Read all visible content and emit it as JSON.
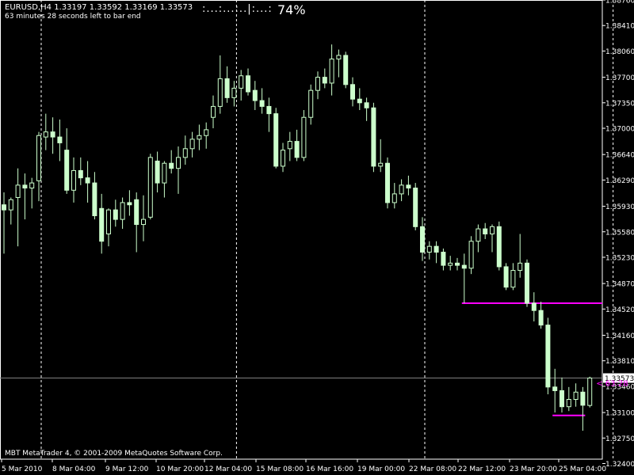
{
  "header": {
    "title": "EURUSD,H4  1.33197 1.33592 1.33169 1.33573",
    "countdown": "63 minutes 28 seconds left to bar end",
    "bar_progress_dots": ":...:...:..|:...:",
    "bar_progress_pct": "74%"
  },
  "footer": {
    "copyright": "MBT MetaTrader 4, © 2001-2009 MetaQuotes Software Corp."
  },
  "colors": {
    "background": "#000000",
    "candle": "#ccffcc",
    "axis": "#ffffff",
    "level_line": "#ff00ff",
    "price_line": "#808080"
  },
  "chart_data": {
    "type": "candlestick",
    "symbol": "EURUSD",
    "timeframe": "H4",
    "current_price": 1.33573,
    "current_price_label": "1.33573",
    "countdown_label": "< 63:28",
    "ylim": [
      1.3246,
      1.3876
    ],
    "y_ticks": [
      "1.38760",
      "1.38410",
      "1.38060",
      "1.37700",
      "1.37350",
      "1.37000",
      "1.36640",
      "1.36290",
      "1.35930",
      "1.35580",
      "1.35230",
      "1.34870",
      "1.34520",
      "1.34160",
      "1.33810",
      "1.33460",
      "1.33100",
      "1.32750",
      "1.32400"
    ],
    "x_ticks": [
      "5 Mar 2010",
      "8 Mar 04:00",
      "9 Mar 12:00",
      "10 Mar 20:00",
      "12 Mar 04:00",
      "15 Mar 08:00",
      "16 Mar 16:00",
      "19 Mar 00:00",
      "22 Mar 08:00",
      "22 Mar 12:00",
      "23 Mar 20:00",
      "25 Mar 04:00"
    ],
    "levels": [
      {
        "price": 1.346,
        "from_bar": 66
      },
      {
        "price": 1.3306,
        "from_bar": 79,
        "to_bar": 83
      }
    ],
    "candles": [
      [
        1.3595,
        1.3612,
        1.3528,
        1.3588
      ],
      [
        1.3588,
        1.3605,
        1.3568,
        1.3602
      ],
      [
        1.3605,
        1.3645,
        1.3538,
        1.3622
      ],
      [
        1.3622,
        1.3638,
        1.3575,
        1.3618
      ],
      [
        1.3618,
        1.3632,
        1.359,
        1.3625
      ],
      [
        1.3628,
        1.3695,
        1.36,
        1.369
      ],
      [
        1.3688,
        1.372,
        1.367,
        1.3695
      ],
      [
        1.3695,
        1.3715,
        1.3665,
        1.3688
      ],
      [
        1.3688,
        1.3712,
        1.3655,
        1.368
      ],
      [
        1.367,
        1.37,
        1.361,
        1.3615
      ],
      [
        1.3615,
        1.366,
        1.3598,
        1.3642
      ],
      [
        1.3642,
        1.366,
        1.3622,
        1.3632
      ],
      [
        1.3632,
        1.3655,
        1.3598,
        1.3625
      ],
      [
        1.3625,
        1.364,
        1.3575,
        1.358
      ],
      [
        1.359,
        1.361,
        1.3528,
        1.3545
      ],
      [
        1.3555,
        1.359,
        1.3538,
        1.3588
      ],
      [
        1.3588,
        1.3602,
        1.3565,
        1.3575
      ],
      [
        1.3575,
        1.3605,
        1.3562,
        1.3598
      ],
      [
        1.3598,
        1.3615,
        1.358,
        1.3595
      ],
      [
        1.3602,
        1.3612,
        1.353,
        1.3568
      ],
      [
        1.3568,
        1.3608,
        1.3545,
        1.3575
      ],
      [
        1.3578,
        1.3665,
        1.3575,
        1.366
      ],
      [
        1.3655,
        1.3668,
        1.3612,
        1.3625
      ],
      [
        1.3625,
        1.3655,
        1.3605,
        1.3652
      ],
      [
        1.3652,
        1.367,
        1.3638,
        1.3645
      ],
      [
        1.3645,
        1.3675,
        1.361,
        1.366
      ],
      [
        1.366,
        1.369,
        1.365,
        1.3672
      ],
      [
        1.3672,
        1.3695,
        1.366,
        1.3685
      ],
      [
        1.3685,
        1.3705,
        1.367,
        1.369
      ],
      [
        1.369,
        1.3708,
        1.3672,
        1.3698
      ],
      [
        1.3715,
        1.3745,
        1.37,
        1.373
      ],
      [
        1.373,
        1.38,
        1.372,
        1.3768
      ],
      [
        1.3768,
        1.3785,
        1.3735,
        1.3742
      ],
      [
        1.3742,
        1.3765,
        1.373,
        1.3755
      ],
      [
        1.3755,
        1.378,
        1.3738,
        1.3772
      ],
      [
        1.3772,
        1.3782,
        1.3745,
        1.375
      ],
      [
        1.3752,
        1.3765,
        1.3725,
        1.3738
      ],
      [
        1.3738,
        1.3755,
        1.372,
        1.373
      ],
      [
        1.373,
        1.3742,
        1.3695,
        1.372
      ],
      [
        1.372,
        1.3728,
        1.3645,
        1.3648
      ],
      [
        1.3648,
        1.368,
        1.364,
        1.367
      ],
      [
        1.3672,
        1.3695,
        1.3655,
        1.3682
      ],
      [
        1.3682,
        1.3698,
        1.3655,
        1.366
      ],
      [
        1.366,
        1.3725,
        1.3655,
        1.3715
      ],
      [
        1.3715,
        1.376,
        1.3705,
        1.3752
      ],
      [
        1.3752,
        1.3778,
        1.374,
        1.377
      ],
      [
        1.377,
        1.3782,
        1.3755,
        1.3762
      ],
      [
        1.3762,
        1.3815,
        1.3745,
        1.3795
      ],
      [
        1.3795,
        1.3808,
        1.377,
        1.38
      ],
      [
        1.38,
        1.3805,
        1.3755,
        1.376
      ],
      [
        1.376,
        1.377,
        1.373,
        1.374
      ],
      [
        1.374,
        1.3755,
        1.3725,
        1.3735
      ],
      [
        1.3735,
        1.3742,
        1.371,
        1.3728
      ],
      [
        1.3728,
        1.3735,
        1.364,
        1.3648
      ],
      [
        1.3648,
        1.3685,
        1.364,
        1.3652
      ],
      [
        1.3652,
        1.366,
        1.359,
        1.3598
      ],
      [
        1.3598,
        1.3625,
        1.359,
        1.361
      ],
      [
        1.361,
        1.363,
        1.36,
        1.3622
      ],
      [
        1.3622,
        1.3635,
        1.3608,
        1.3618
      ],
      [
        1.3618,
        1.3625,
        1.356,
        1.3565
      ],
      [
        1.3565,
        1.3578,
        1.3518,
        1.353
      ],
      [
        1.353,
        1.3545,
        1.352,
        1.3538
      ],
      [
        1.3538,
        1.3545,
        1.3515,
        1.353
      ],
      [
        1.353,
        1.3535,
        1.3505,
        1.3512
      ],
      [
        1.3512,
        1.3525,
        1.3505,
        1.3515
      ],
      [
        1.3515,
        1.3522,
        1.3505,
        1.3512
      ],
      [
        1.3512,
        1.3528,
        1.346,
        1.3508
      ],
      [
        1.3508,
        1.3552,
        1.35,
        1.3545
      ],
      [
        1.3545,
        1.3568,
        1.353,
        1.3562
      ],
      [
        1.3562,
        1.357,
        1.3548,
        1.3555
      ],
      [
        1.3555,
        1.3568,
        1.353,
        1.3565
      ],
      [
        1.3565,
        1.3572,
        1.3505,
        1.351
      ],
      [
        1.351,
        1.3515,
        1.3478,
        1.3482
      ],
      [
        1.3482,
        1.3515,
        1.3478,
        1.3505
      ],
      [
        1.3505,
        1.3555,
        1.3495,
        1.3515
      ],
      [
        1.3515,
        1.352,
        1.3455,
        1.346
      ],
      [
        1.346,
        1.3475,
        1.3435,
        1.345
      ],
      [
        1.345,
        1.3462,
        1.3425,
        1.343
      ],
      [
        1.343,
        1.344,
        1.3335,
        1.3345
      ],
      [
        1.3345,
        1.337,
        1.331,
        1.334
      ],
      [
        1.334,
        1.3358,
        1.331,
        1.3318
      ],
      [
        1.3318,
        1.3345,
        1.3312,
        1.3328
      ],
      [
        1.3328,
        1.335,
        1.3318,
        1.3338
      ],
      [
        1.3338,
        1.3345,
        1.3285,
        1.332
      ],
      [
        1.33197,
        1.33592,
        1.33169,
        1.33573
      ]
    ]
  }
}
